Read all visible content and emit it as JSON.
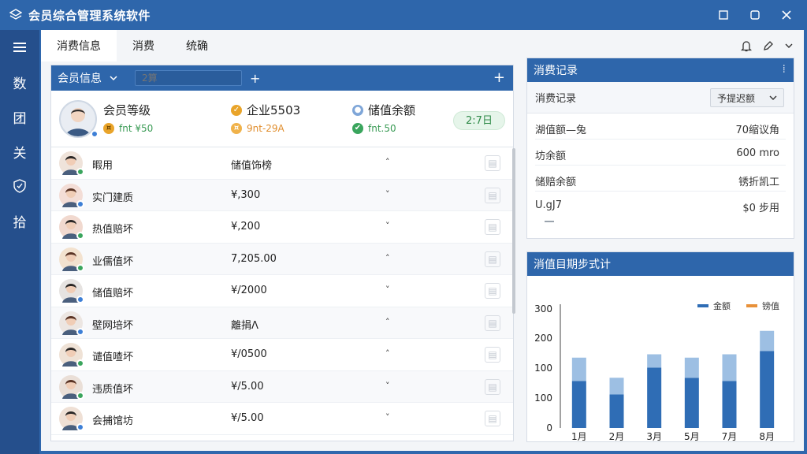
{
  "window": {
    "title": "会员综合管理系统软件"
  },
  "sidebar": {
    "items": [
      {
        "icon": "menu-icon",
        "label": "☰"
      },
      {
        "label": "数"
      },
      {
        "label": "团"
      },
      {
        "label": "关"
      },
      {
        "icon": "shield-icon",
        "label": ""
      },
      {
        "label": "拾"
      }
    ]
  },
  "tabs": [
    {
      "label": "消费信息"
    },
    {
      "label": "消费"
    },
    {
      "label": "统确"
    }
  ],
  "members_panel": {
    "header_label": "会员信息",
    "search_placeholder": "2算",
    "summary": {
      "level_title": "会员等级",
      "level_sub": "fnt ¥50",
      "company_title": "企业5503",
      "company_sub": "9nt-29A",
      "balance_title": "储值余额",
      "balance_sub": "fnt.50",
      "badge": "2:7日"
    },
    "rows": [
      {
        "name": "暇用",
        "amount": "储值饰榜",
        "arrow": "˄",
        "status": "#3aa55d",
        "avatar_bg": "#efe3da"
      },
      {
        "name": "实门建质",
        "amount": "¥,300",
        "arrow": "˅",
        "status": "#3d7fd6",
        "avatar_bg": "#f3ddd6"
      },
      {
        "name": "热值赔坏",
        "amount": "¥,200",
        "arrow": "˅",
        "status": "#3aa55d",
        "avatar_bg": "#f1d9cf"
      },
      {
        "name": "业儒值坏",
        "amount": "7,205.00",
        "arrow": "˄",
        "status": "#3aa55d",
        "avatar_bg": "#f3e2cf"
      },
      {
        "name": "储值赔坏",
        "amount": "¥/2000",
        "arrow": "˅",
        "status": "#3d7fd6",
        "avatar_bg": "#e6e3e1"
      },
      {
        "name": "壁网培坏",
        "amount": "離捐Λ",
        "arrow": "˄",
        "status": "#3d7fd6",
        "avatar_bg": "#ece6e2"
      },
      {
        "name": "谴值喳坏",
        "amount": "¥/0500",
        "arrow": "˄",
        "status": "#3aa55d",
        "avatar_bg": "#efe2d6"
      },
      {
        "name": "违质值坏",
        "amount": "¥/5.00",
        "arrow": "˅",
        "status": "#3aa55d",
        "avatar_bg": "#eadfd7"
      },
      {
        "name": "会捕馆坊",
        "amount": "¥/5.00",
        "arrow": "˅",
        "status": "#3d7fd6",
        "avatar_bg": "#efe0d5"
      }
    ]
  },
  "records_panel": {
    "title": "消费记录",
    "subtitle": "消费记录",
    "select_value": "予提迟额",
    "items": [
      {
        "key": "湖值额—兔",
        "value": "70缩议角"
      },
      {
        "key": "坊余额",
        "value": "600 mro"
      },
      {
        "key": "储赔余额",
        "value": "锈折凯工"
      },
      {
        "key": "U.gJ7",
        "value": "$0 步用"
      }
    ]
  },
  "chart_panel": {
    "title": "消值目期步式计"
  },
  "colors": {
    "primary": "#2e66ab",
    "sidebar": "#254f8c",
    "bar_dark": "#2f6db5",
    "bar_light": "#9dbfe3",
    "legend_orange": "#e8913a"
  },
  "chart_data": {
    "type": "bar",
    "categories": [
      "1月",
      "2月",
      "3月",
      "5月",
      "7月",
      "8月"
    ],
    "series": [
      {
        "name": "金额",
        "values": [
          70,
          50,
          90,
          75,
          70,
          115
        ]
      },
      {
        "name": "",
        "values": [
          35,
          25,
          20,
          30,
          40,
          30
        ]
      }
    ],
    "stacked": true,
    "legend": [
      {
        "name": "金额",
        "color": "#2f6db5"
      },
      {
        "name": "镑值",
        "color": "#e8913a"
      }
    ],
    "y_ticks": [
      "300",
      "200",
      "100",
      "100",
      "0"
    ],
    "ylim": [
      0,
      180
    ],
    "grid": false,
    "legend_position": "top-right"
  }
}
